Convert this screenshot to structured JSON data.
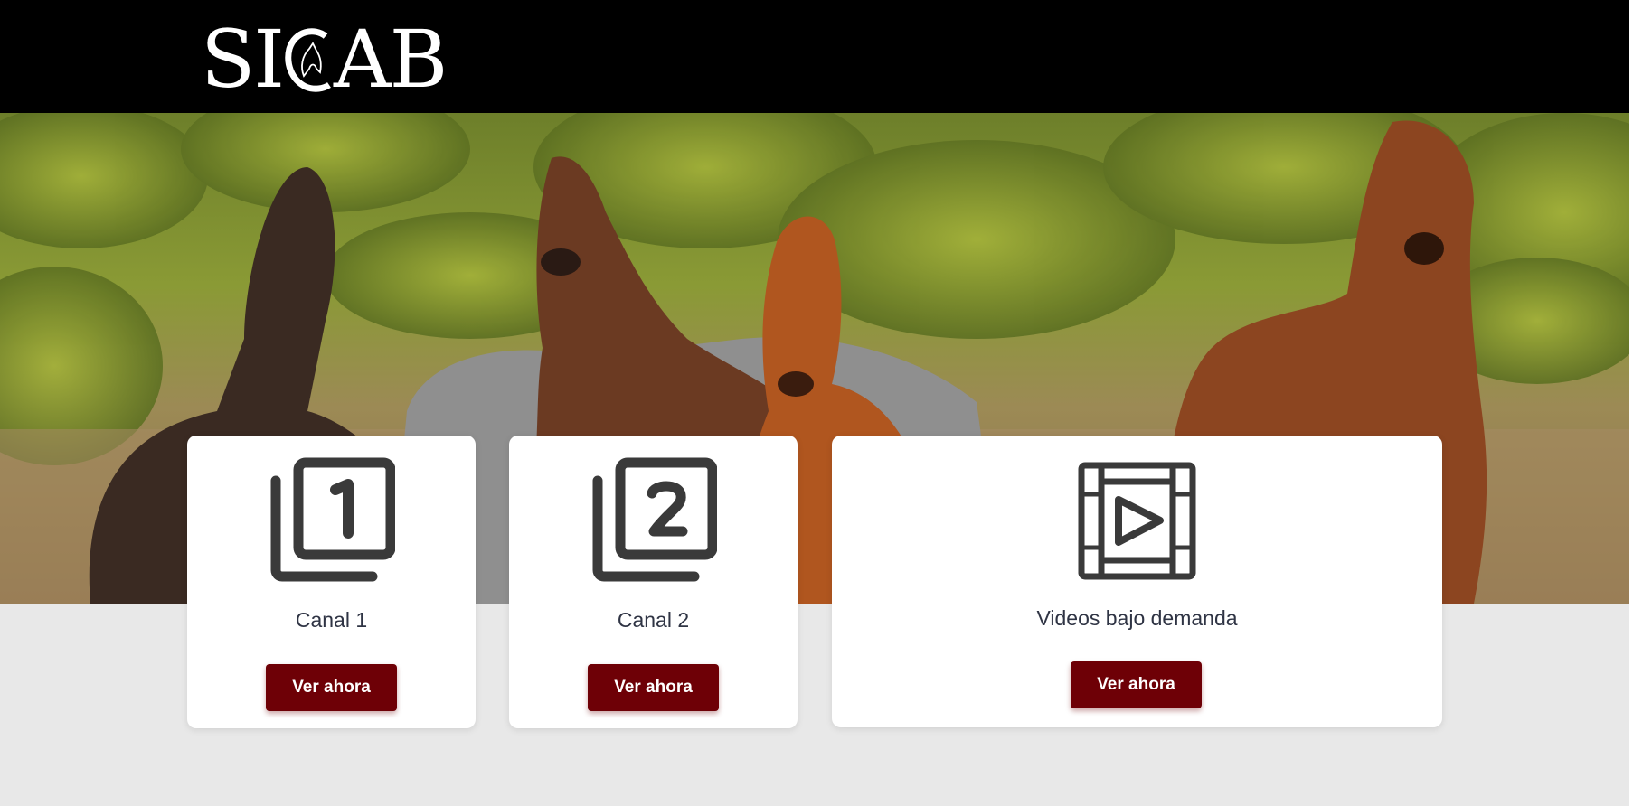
{
  "header": {
    "logo_text_left": "SI",
    "logo_text_right": "AB",
    "logo_alt": "SICAB"
  },
  "colors": {
    "header_bg": "#000000",
    "page_bg": "#e8e8e8",
    "button_bg": "#6e0006",
    "icon": "#3a3a3a",
    "title_text": "#2f3444"
  },
  "hero": {
    "icon": "horses-photo"
  },
  "cards": [
    {
      "icon": "channel-1-icon",
      "title": "Canal 1",
      "button_label": "Ver ahora"
    },
    {
      "icon": "channel-2-icon",
      "title": "Canal 2",
      "button_label": "Ver ahora"
    },
    {
      "icon": "video-film-icon",
      "title": "Videos bajo demanda",
      "button_label": "Ver ahora"
    }
  ]
}
